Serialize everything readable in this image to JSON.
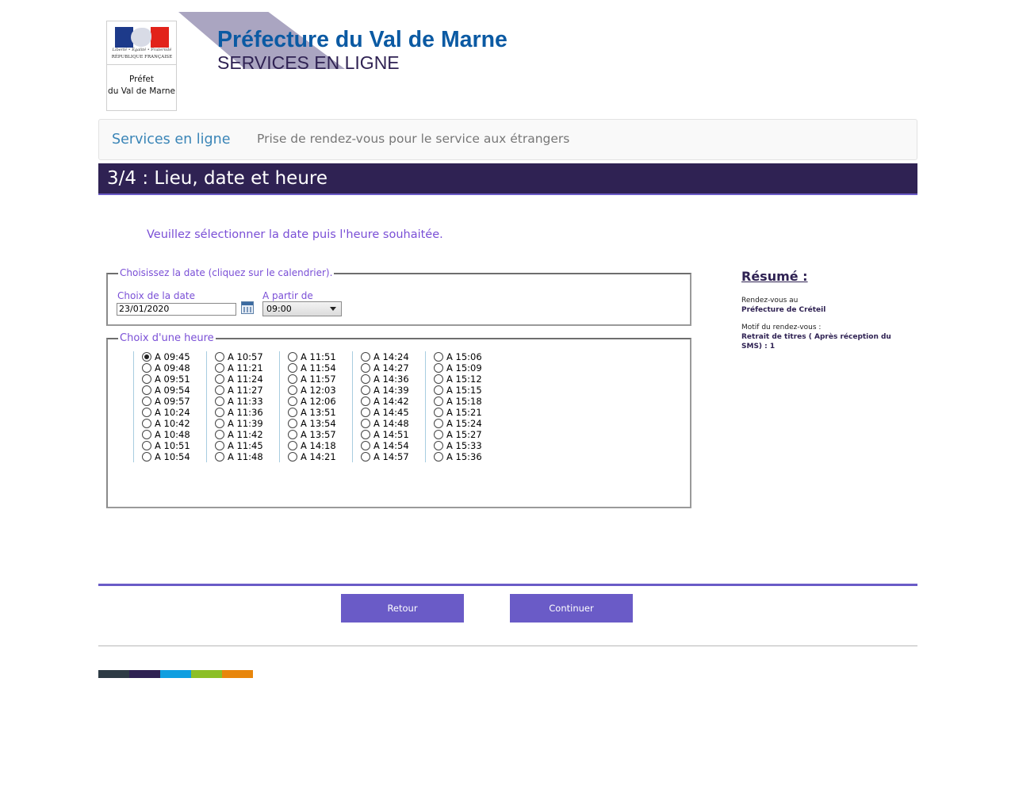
{
  "header": {
    "logo": {
      "motto": "Liberté • Égalité • Fraternité",
      "republic": "RÉPUBLIQUE FRANÇAISE",
      "prefet_line1": "Préfet",
      "prefet_line2": "du Val de Marne"
    },
    "title": "Préfecture du Val de Marne",
    "subtitle": "SERVICES EN LIGNE"
  },
  "nav": {
    "brand": "Services en ligne",
    "page_title": "Prise de rendez-vous pour le service aux étrangers"
  },
  "step": {
    "title": "3/4 : Lieu, date et heure"
  },
  "instruction": "Veuillez sélectionner la date puis l'heure souhaitée.",
  "date_section": {
    "legend": "Choisissez la date (cliquez sur le calendrier).",
    "date_label": "Choix de la date",
    "date_value": "23/01/2020",
    "from_label": "A partir de",
    "from_value": "09:00"
  },
  "hour_section": {
    "legend": "Choix d'une heure",
    "selected": "A 09:45",
    "columns": [
      [
        "A 09:45",
        "A 09:48",
        "A 09:51",
        "A 09:54",
        "A 09:57",
        "A 10:24",
        "A 10:42",
        "A 10:48",
        "A 10:51",
        "A 10:54"
      ],
      [
        "A 10:57",
        "A 11:21",
        "A 11:24",
        "A 11:27",
        "A 11:33",
        "A 11:36",
        "A 11:39",
        "A 11:42",
        "A 11:45",
        "A 11:48"
      ],
      [
        "A 11:51",
        "A 11:54",
        "A 11:57",
        "A 12:03",
        "A 12:06",
        "A 13:51",
        "A 13:54",
        "A 13:57",
        "A 14:18",
        "A 14:21"
      ],
      [
        "A 14:24",
        "A 14:27",
        "A 14:36",
        "A 14:39",
        "A 14:42",
        "A 14:45",
        "A 14:48",
        "A 14:51",
        "A 14:54",
        "A 14:57"
      ],
      [
        "A 15:06",
        "A 15:09",
        "A 15:12",
        "A 15:15",
        "A 15:18",
        "A 15:21",
        "A 15:24",
        "A 15:27",
        "A 15:33",
        "A 15:36"
      ]
    ]
  },
  "resume": {
    "title": "Résumé :",
    "location_label": "Rendez-vous au",
    "location_value": "Préfecture de Créteil",
    "motif_label": "Motif du rendez-vous :",
    "motif_value": "Retrait de titres ( Après réception du SMS) : 1"
  },
  "actions": {
    "back_label": "Retour",
    "continue_label": "Continuer"
  },
  "colors": {
    "primary_dark": "#2f2253",
    "accent": "#6a5bc7",
    "link_blue": "#0b5aa3",
    "text_purple": "#7a4fd6",
    "strip": [
      "#2e3b45",
      "#2f2253",
      "#0f9ee0",
      "#8cbf26",
      "#e8860c"
    ]
  }
}
